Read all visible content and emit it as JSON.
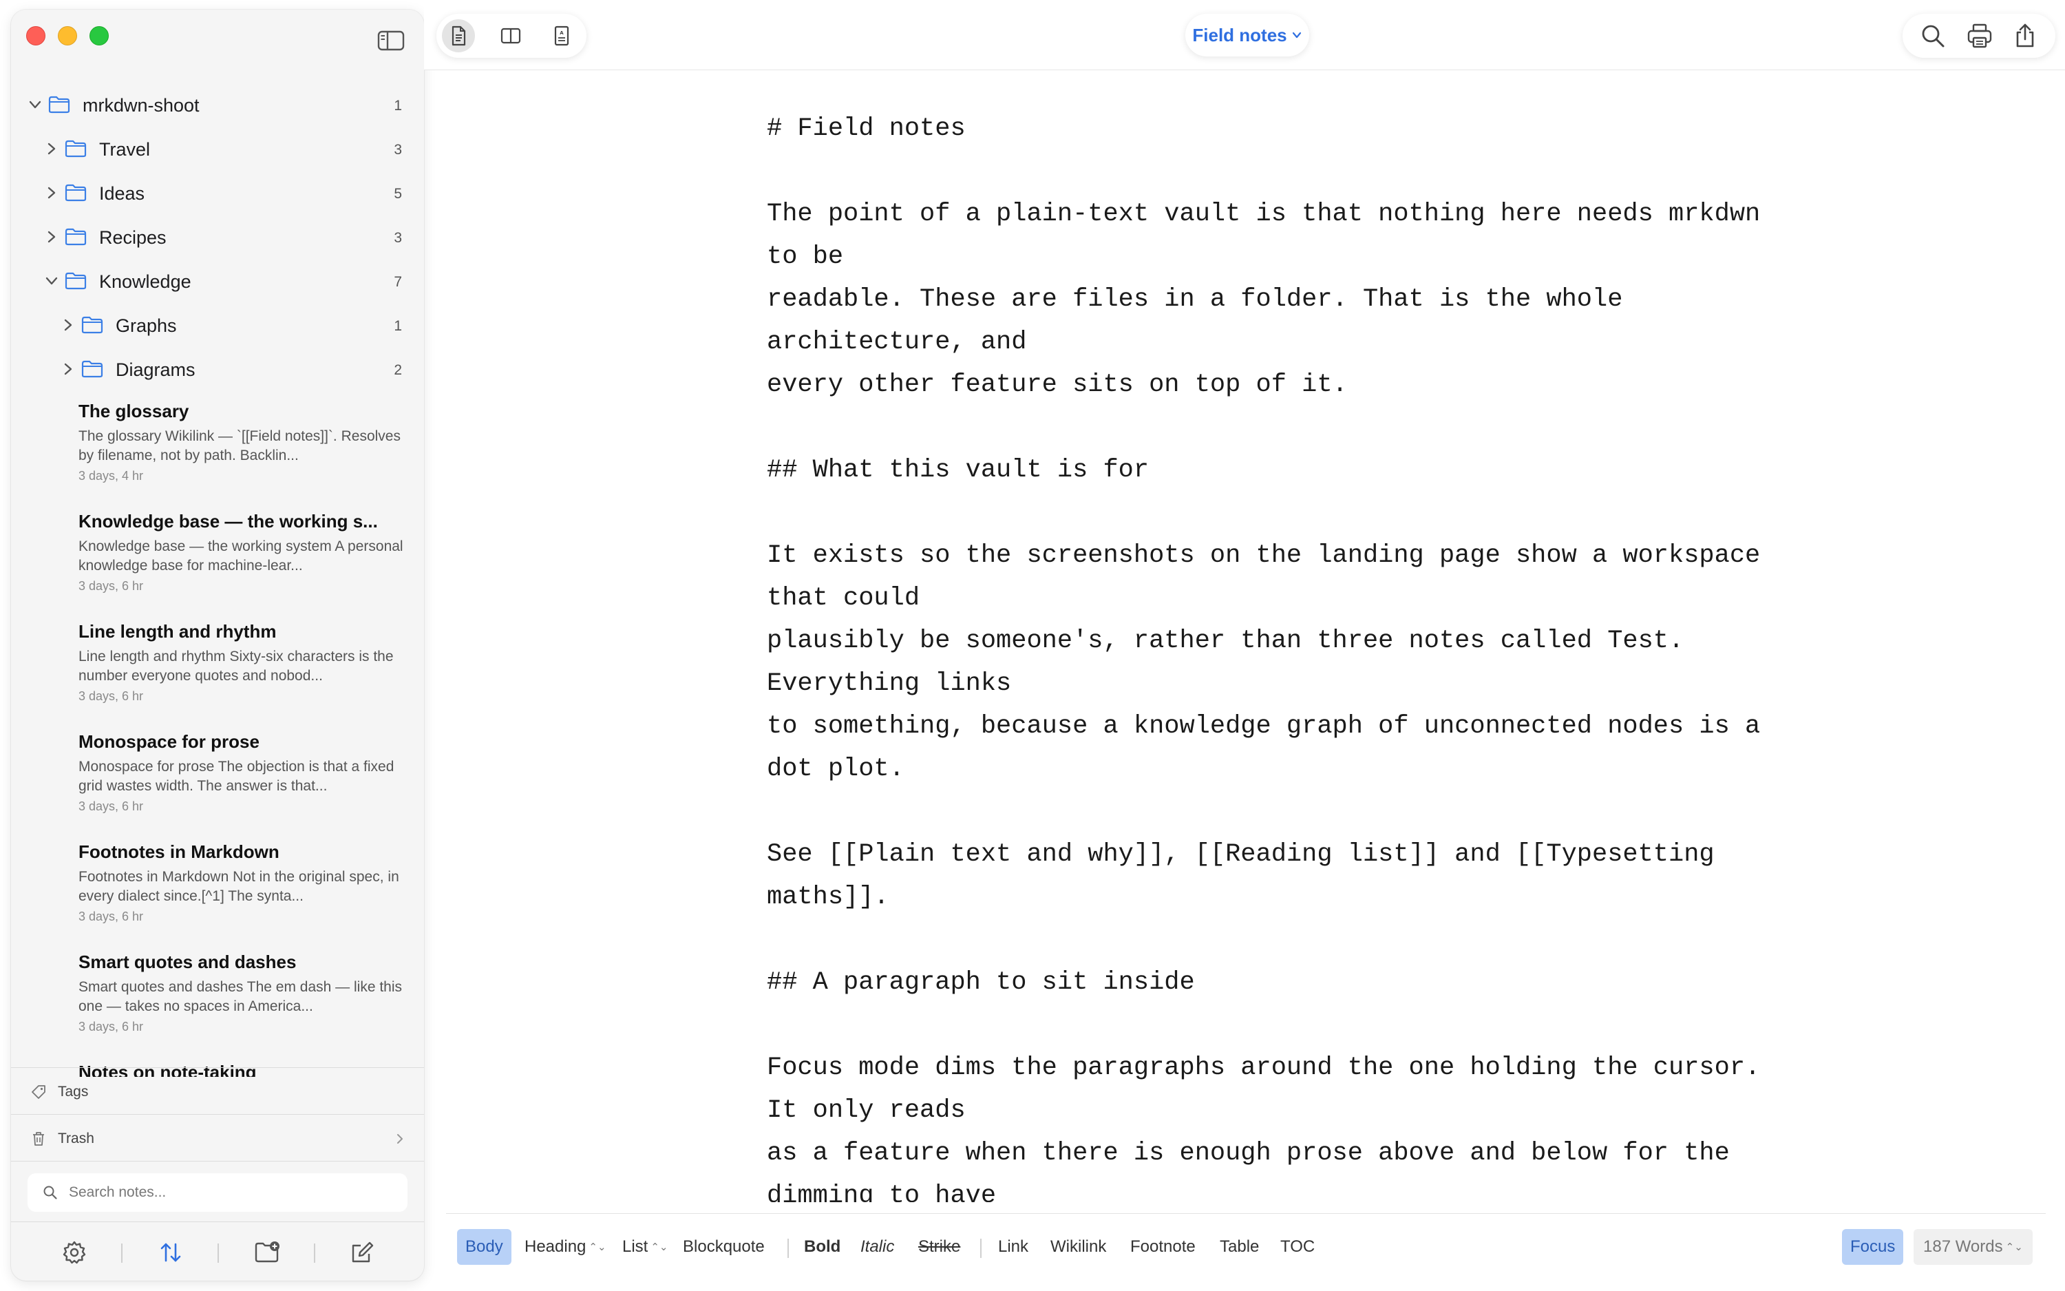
{
  "sidebar": {
    "tree": [
      {
        "label": "mrkdwn-shoot",
        "count": "1",
        "expanded": true
      },
      {
        "label": "Travel",
        "count": "3",
        "expanded": false
      },
      {
        "label": "Ideas",
        "count": "5",
        "expanded": false
      },
      {
        "label": "Recipes",
        "count": "3",
        "expanded": false
      },
      {
        "label": "Knowledge",
        "count": "7",
        "expanded": true
      },
      {
        "label": "Graphs",
        "count": "1",
        "expanded": false
      },
      {
        "label": "Diagrams",
        "count": "2",
        "expanded": false
      }
    ],
    "notes": [
      {
        "title": "The glossary",
        "excerpt": "The glossary Wikilink — `[[Field notes]]`. Resolves by filename, not by path. Backlin...",
        "time": "3 days, 4 hr"
      },
      {
        "title": "Knowledge base — the working s...",
        "excerpt": "Knowledge base — the working system A personal knowledge base for machine-lear...",
        "time": "3 days, 6 hr"
      },
      {
        "title": "Line length and rhythm",
        "excerpt": "Line length and rhythm Sixty-six characters is the number everyone quotes and nobod...",
        "time": "3 days, 6 hr"
      },
      {
        "title": "Monospace for prose",
        "excerpt": "Monospace for prose The objection is that a fixed grid wastes width. The answer is that...",
        "time": "3 days, 6 hr"
      },
      {
        "title": "Footnotes in Markdown",
        "excerpt": "Footnotes in Markdown Not in the original spec, in every dialect since.[^1] The synta...",
        "time": "3 days, 6 hr"
      },
      {
        "title": "Smart quotes and dashes",
        "excerpt": "Smart quotes and dashes The em dash — like this one — takes no spaces in America...",
        "time": "3 days, 6 hr"
      },
      {
        "title": "Notes on note-taking",
        "excerpt": "",
        "time": ""
      }
    ],
    "tags_label": "Tags",
    "trash_label": "Trash",
    "search_placeholder": "Search notes..."
  },
  "topbar": {
    "title": "Field notes"
  },
  "editor": {
    "lines": [
      "# Field notes",
      "",
      "The point of a plain-text vault is that nothing here needs mrkdwn",
      "to be",
      "readable. These are files in a folder. That is the whole",
      "architecture, and",
      "every other feature sits on top of it.",
      "",
      "## What this vault is for",
      "",
      "It exists so the screenshots on the landing page show a workspace",
      "that could",
      "plausibly be someone's, rather than three notes called Test.",
      "Everything links",
      "to something, because a knowledge graph of unconnected nodes is a",
      "dot plot.",
      "",
      "See [[Plain text and why]], [[Reading list]] and [[Typesetting",
      "maths]].",
      "",
      "## A paragraph to sit inside",
      "",
      "Focus mode dims the paragraphs around the one holding the cursor.",
      "It only reads",
      "as a feature when there is enough prose above and below for the",
      "dimming to have"
    ]
  },
  "formatbar": {
    "body": "Body",
    "heading": "Heading",
    "list": "List",
    "blockquote": "Blockquote",
    "bold": "Bold",
    "italic": "Italic",
    "strike": "Strike",
    "link": "Link",
    "wikilink": "Wikilink",
    "footnote": "Footnote",
    "table": "Table",
    "toc": "TOC",
    "focus": "Focus",
    "word_count": "187 Words",
    "updown_glyph": "⌃⌄"
  },
  "colors": {
    "accent": "#2f6fe0",
    "active_bg": "#b8d1f7",
    "folder_icon": "#3b7fe6",
    "traffic_red": "#fe5f57",
    "traffic_yellow": "#febc2e",
    "traffic_green": "#28c840"
  }
}
